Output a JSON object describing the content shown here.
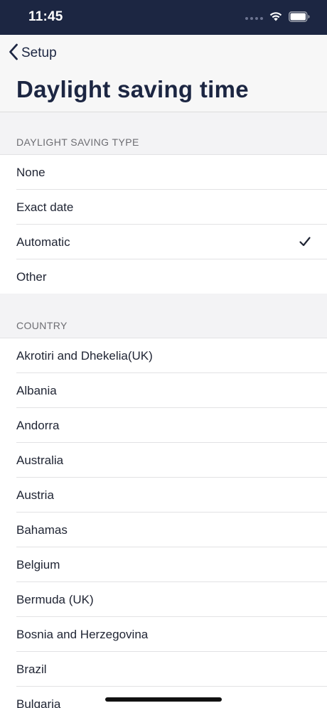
{
  "status_bar": {
    "time": "11:45"
  },
  "nav": {
    "back_label": "Setup",
    "title": "Daylight saving time"
  },
  "dst_section": {
    "header": "DAYLIGHT SAVING TYPE",
    "options": [
      "None",
      "Exact date",
      "Automatic",
      "Other"
    ],
    "selected": "Automatic"
  },
  "country_section": {
    "header": "COUNTRY",
    "countries": [
      "Akrotiri and Dhekelia(UK)",
      "Albania",
      "Andorra",
      "Australia",
      "Austria",
      "Bahamas",
      "Belgium",
      "Bermuda (UK)",
      "Bosnia and Herzegovina",
      "Brazil",
      "Bulgaria"
    ]
  },
  "colors": {
    "header_bg": "#1c2642",
    "title_color": "#1c2642"
  },
  "icons": {
    "back": "chevron-left-icon",
    "check": "checkmark-icon",
    "wifi": "wifi-icon",
    "battery": "battery-icon"
  }
}
